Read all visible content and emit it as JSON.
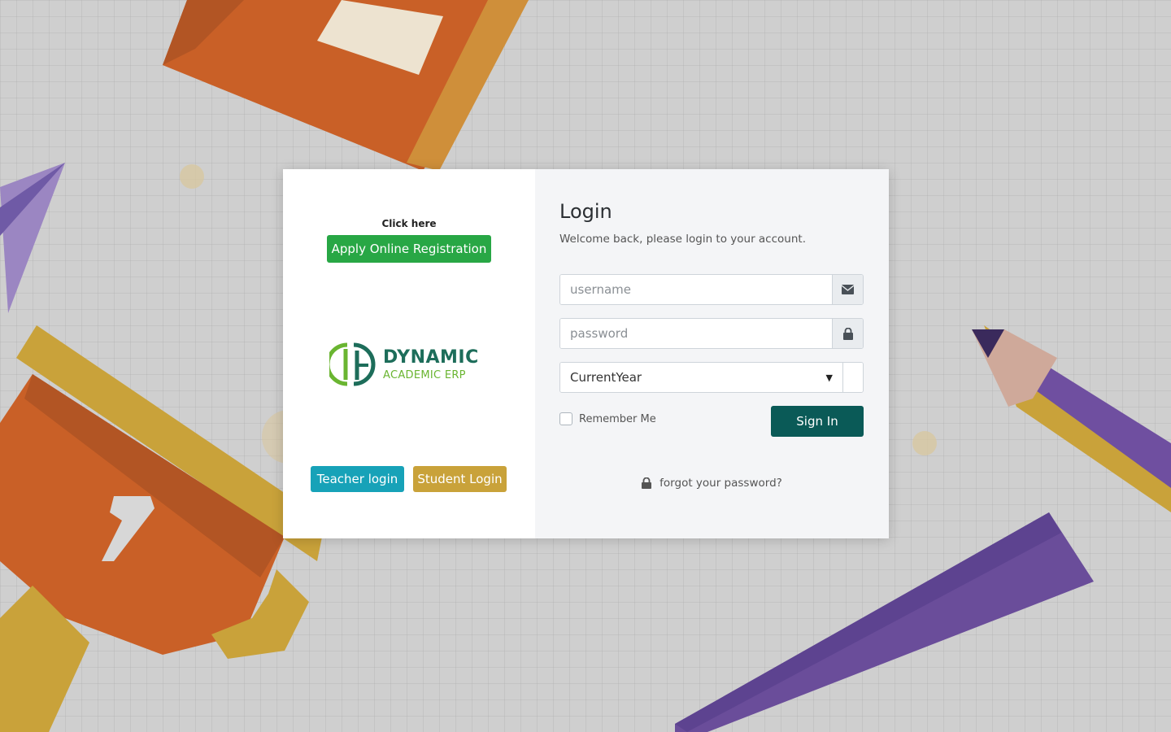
{
  "left_panel": {
    "click_here": "Click here",
    "apply_button": "Apply Online Registration",
    "logo": {
      "line1": "DYNAMIC",
      "line2": "ACADEMIC ERP"
    },
    "teacher_button": "Teacher login",
    "student_button": "Student Login"
  },
  "login": {
    "title": "Login",
    "subtitle": "Welcome back, please login to your account.",
    "username_placeholder": "username",
    "password_placeholder": "password",
    "year_selected": "CurrentYear",
    "remember_label": "Remember Me",
    "signin_button": "Sign In",
    "forgot_link": "forgot your password?"
  },
  "icons": {
    "username": "envelope-icon",
    "password": "lock-icon",
    "forgot": "lock-icon"
  },
  "colors": {
    "apply": "#28a745",
    "teacher": "#17a2b8",
    "student": "#c9a23a",
    "signin": "#0a5a57",
    "logo_dark": "#1d6d5a",
    "logo_light": "#6ab531"
  }
}
